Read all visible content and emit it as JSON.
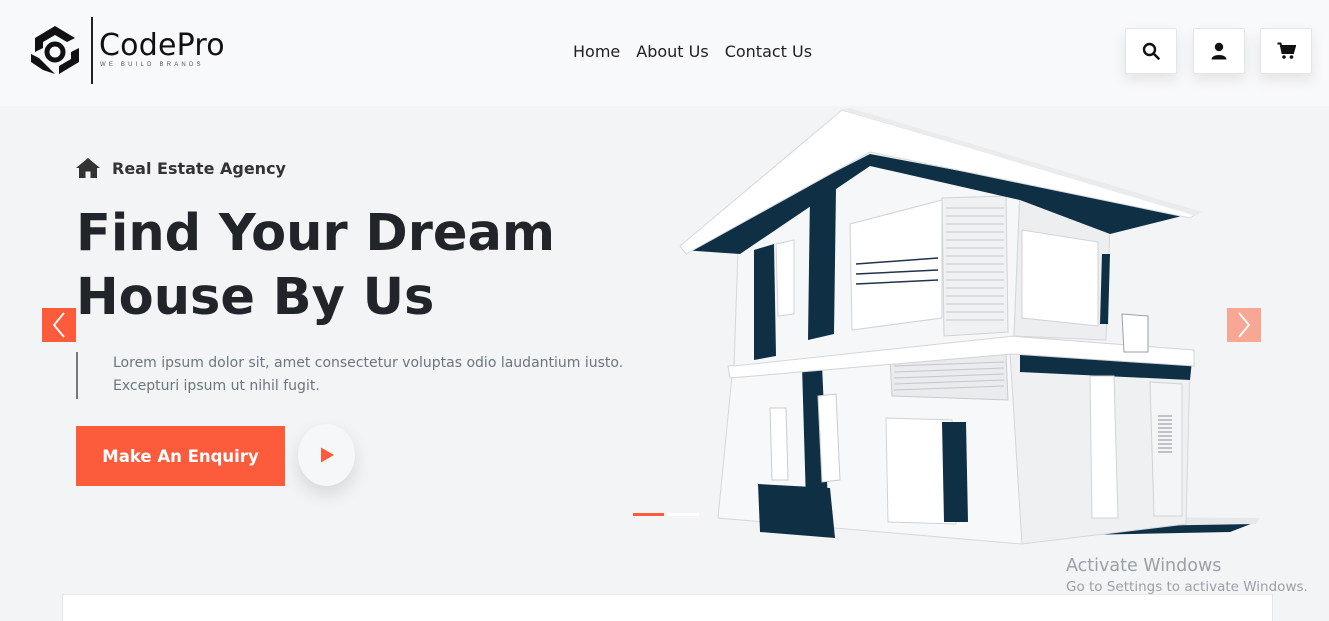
{
  "brand": {
    "name": "CodePro",
    "tagline": "WE BUILD BRANDS"
  },
  "nav": {
    "items": [
      "Home",
      "About Us",
      "Contact Us"
    ]
  },
  "header_icons": [
    "search-icon",
    "user-icon",
    "cart-icon"
  ],
  "hero": {
    "label": "Real Estate Agency",
    "title_line1": "Find Your Dream",
    "title_line2": "House By Us",
    "desc_line1": "Lorem ipsum dolor sit, amet consectetur voluptas odio laudantium iusto.",
    "desc_line2": "Excepturi ipsum ut nihil fugit.",
    "cta_label": "Make An Enquiry"
  },
  "slider": {
    "slide_count": 2,
    "active_slide": 1
  },
  "colors": {
    "accent": "#fc5c3c",
    "accent_light": "#f8a794",
    "house_dark": "#0f2f45",
    "text_dark": "#212529"
  },
  "watermark": {
    "line1": "Activate Windows",
    "line2": "Go to Settings to activate Windows."
  }
}
